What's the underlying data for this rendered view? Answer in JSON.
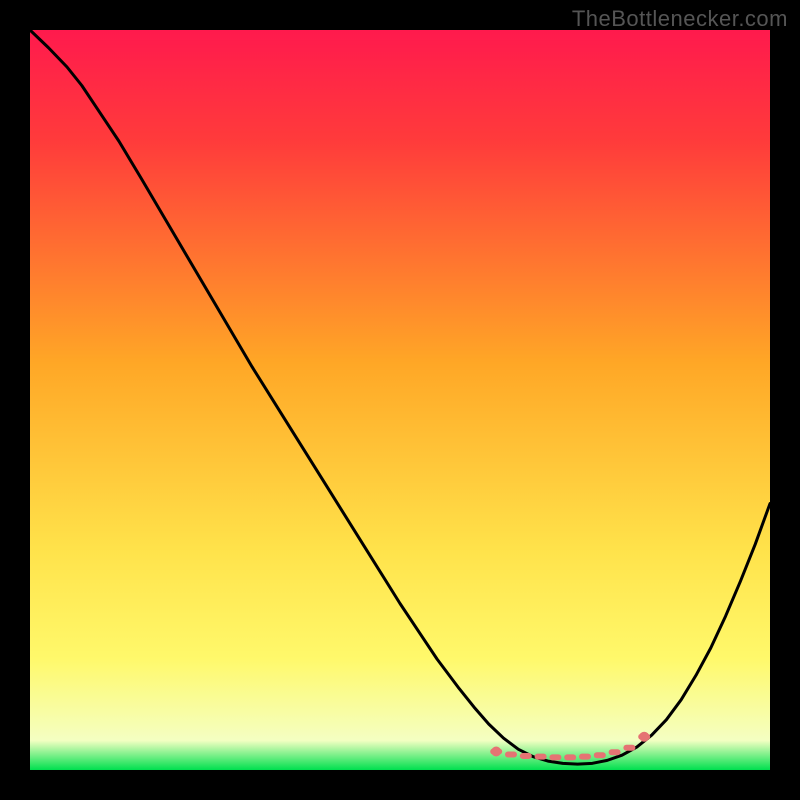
{
  "watermark": "TheBottlenecker.com",
  "chart_data": {
    "type": "line",
    "title": "",
    "xlabel": "",
    "ylabel": "",
    "xlim": [
      0,
      100
    ],
    "ylim": [
      0,
      100
    ],
    "background_gradient": {
      "stops": [
        {
          "offset": 0.0,
          "color": "#ff1a4d"
        },
        {
          "offset": 0.15,
          "color": "#ff3b3b"
        },
        {
          "offset": 0.45,
          "color": "#ffa726"
        },
        {
          "offset": 0.7,
          "color": "#ffe24a"
        },
        {
          "offset": 0.85,
          "color": "#fff96b"
        },
        {
          "offset": 0.96,
          "color": "#f4ffc2"
        },
        {
          "offset": 1.0,
          "color": "#00e04f"
        }
      ]
    },
    "series": [
      {
        "name": "curve",
        "color": "#000000",
        "stroke_width": 3,
        "points": [
          {
            "x": 0.0,
            "y": 100.0
          },
          {
            "x": 2.5,
            "y": 97.6
          },
          {
            "x": 5.0,
            "y": 95.0
          },
          {
            "x": 7.0,
            "y": 92.5
          },
          {
            "x": 9.0,
            "y": 89.5
          },
          {
            "x": 12.0,
            "y": 85.0
          },
          {
            "x": 15.0,
            "y": 80.0
          },
          {
            "x": 20.0,
            "y": 71.5
          },
          {
            "x": 25.0,
            "y": 63.0
          },
          {
            "x": 30.0,
            "y": 54.5
          },
          {
            "x": 35.0,
            "y": 46.5
          },
          {
            "x": 40.0,
            "y": 38.5
          },
          {
            "x": 45.0,
            "y": 30.5
          },
          {
            "x": 50.0,
            "y": 22.5
          },
          {
            "x": 55.0,
            "y": 15.0
          },
          {
            "x": 58.0,
            "y": 11.0
          },
          {
            "x": 60.0,
            "y": 8.5
          },
          {
            "x": 62.0,
            "y": 6.2
          },
          {
            "x": 64.0,
            "y": 4.3
          },
          {
            "x": 66.0,
            "y": 2.8
          },
          {
            "x": 68.0,
            "y": 1.8
          },
          {
            "x": 70.0,
            "y": 1.2
          },
          {
            "x": 72.0,
            "y": 0.9
          },
          {
            "x": 74.0,
            "y": 0.8
          },
          {
            "x": 76.0,
            "y": 0.9
          },
          {
            "x": 78.0,
            "y": 1.3
          },
          {
            "x": 80.0,
            "y": 2.0
          },
          {
            "x": 82.0,
            "y": 3.1
          },
          {
            "x": 84.0,
            "y": 4.7
          },
          {
            "x": 86.0,
            "y": 6.8
          },
          {
            "x": 88.0,
            "y": 9.5
          },
          {
            "x": 90.0,
            "y": 12.8
          },
          {
            "x": 92.0,
            "y": 16.5
          },
          {
            "x": 94.0,
            "y": 20.8
          },
          {
            "x": 96.0,
            "y": 25.5
          },
          {
            "x": 98.0,
            "y": 30.5
          },
          {
            "x": 100.0,
            "y": 36.0
          }
        ]
      },
      {
        "name": "trough-markers",
        "color": "#e57373",
        "type": "marker-band",
        "points": [
          {
            "x": 63.0,
            "y": 2.5
          },
          {
            "x": 65.0,
            "y": 2.1
          },
          {
            "x": 67.0,
            "y": 1.9
          },
          {
            "x": 69.0,
            "y": 1.8
          },
          {
            "x": 71.0,
            "y": 1.7
          },
          {
            "x": 73.0,
            "y": 1.7
          },
          {
            "x": 75.0,
            "y": 1.8
          },
          {
            "x": 77.0,
            "y": 2.0
          },
          {
            "x": 79.0,
            "y": 2.4
          },
          {
            "x": 81.0,
            "y": 3.0
          },
          {
            "x": 83.0,
            "y": 4.5
          }
        ]
      }
    ]
  }
}
